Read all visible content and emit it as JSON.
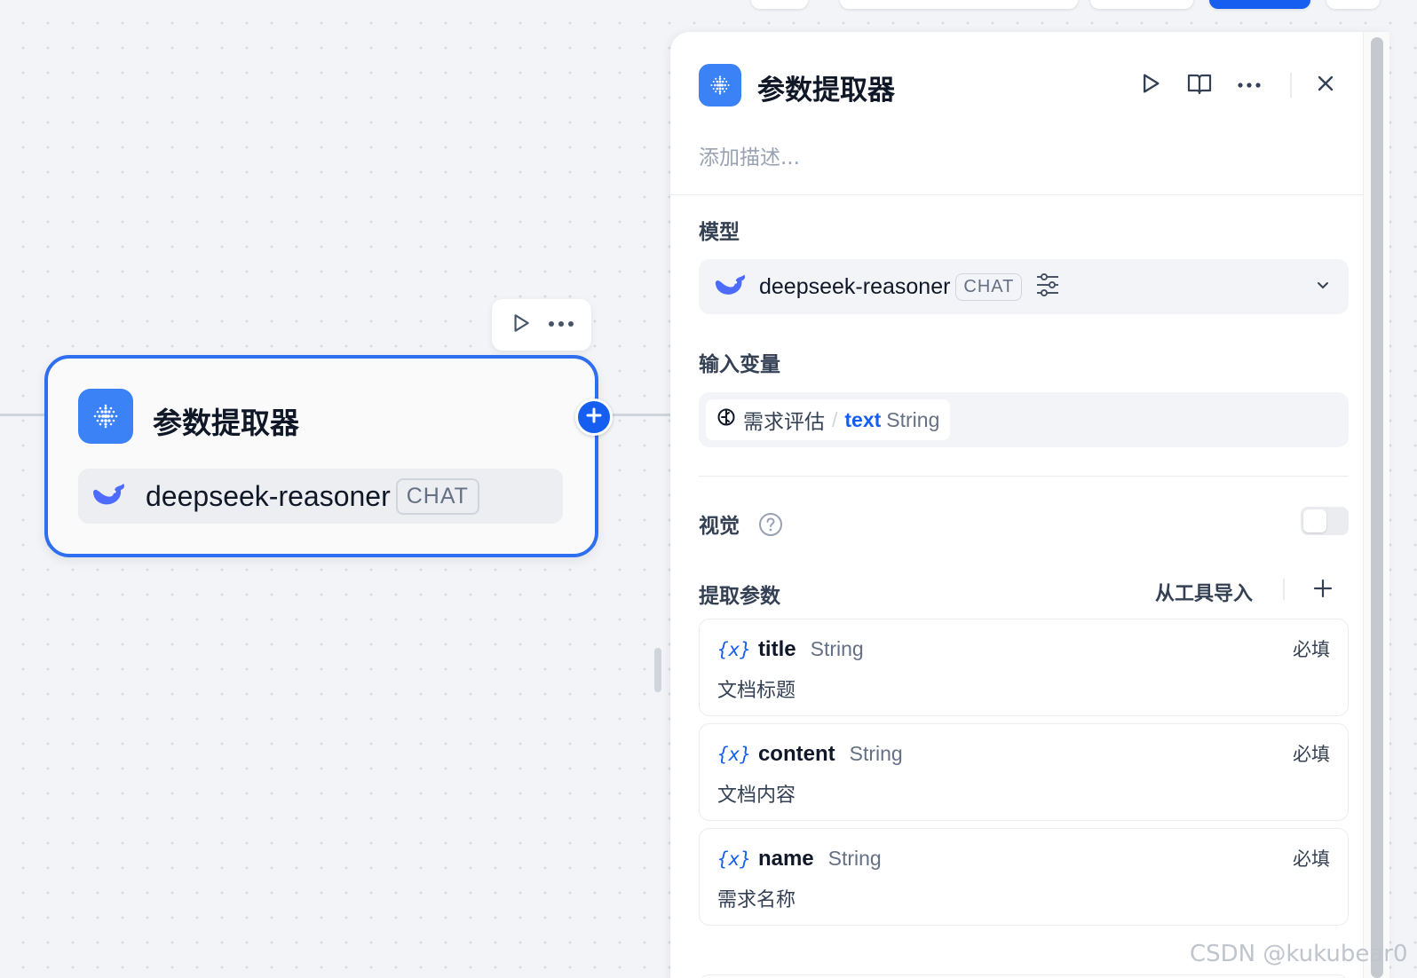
{
  "node": {
    "title": "参数提取器",
    "model_name": "deepseek-reasoner",
    "model_badge": "CHAT"
  },
  "panel": {
    "title": "参数提取器",
    "description_placeholder": "添加描述...",
    "model_section_label": "模型",
    "model_name": "deepseek-reasoner",
    "model_badge": "CHAT",
    "input_section_label": "输入变量",
    "input_var": {
      "node_name": "需求评估",
      "separator": "/",
      "var_name": "text",
      "var_type": "String"
    },
    "vision_label": "视觉",
    "vision_enabled": false,
    "extract_section_label": "提取参数",
    "import_from_tool": "从工具导入",
    "params": [
      {
        "icon": "{x}",
        "name": "title",
        "type": "String",
        "description": "文档标题",
        "required_label": "必填"
      },
      {
        "icon": "{x}",
        "name": "content",
        "type": "String",
        "description": "文档内容",
        "required_label": "必填"
      },
      {
        "icon": "{x}",
        "name": "name",
        "type": "String",
        "description": "需求名称",
        "required_label": "必填"
      }
    ]
  },
  "icons": {
    "node_type": "parameter-extractor-icon",
    "model_logo": "deepseek-whale-icon",
    "run": "play-icon",
    "docs": "book-open-icon",
    "more": "more-horizontal-icon",
    "close": "close-icon",
    "config": "sliders-icon",
    "dropdown": "chevron-down-icon",
    "help": "question-circle-icon",
    "add": "plus-icon",
    "variable_source": "node-source-icon"
  },
  "colors": {
    "accent": "#155eef",
    "node_icon_bg": "#3b82f6",
    "canvas_bg": "#f2f4f7"
  },
  "watermark": "CSDN @kukubear0"
}
